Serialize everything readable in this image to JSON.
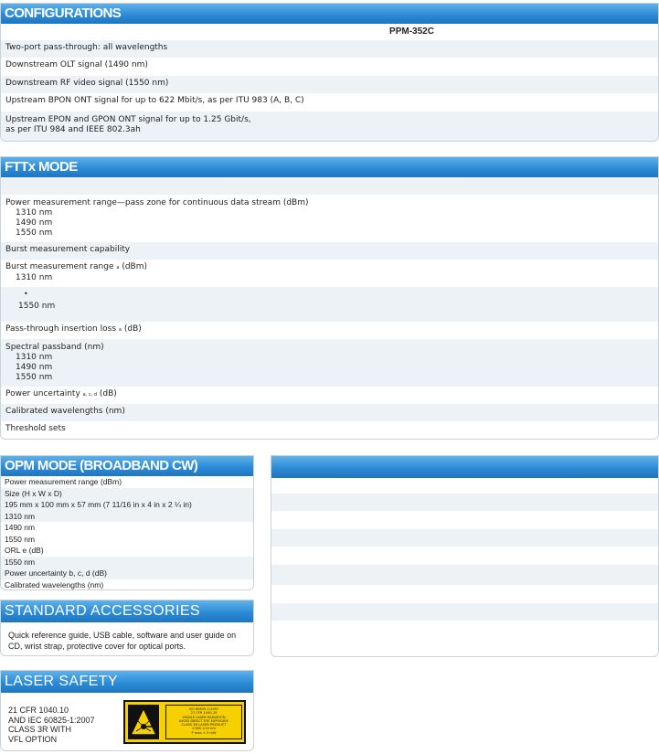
{
  "configurations": {
    "title": "CONFIGURATIONS",
    "column_header": "PPM-352C",
    "rows": [
      "Two-port pass-through: all wavelengths",
      "Downstream OLT signal (1490 nm)",
      "Downstream RF video signal (1550 nm)",
      "Upstream BPON ONT signal for up to 622 Mbit/s, as per ITU 983 (A, B, C)",
      "Upstream EPON and GPON ONT signal for up to 1.25 Gbit/s,",
      "as per ITU 984 and IEEE 802.3ah"
    ]
  },
  "fttx": {
    "title": "FTTx MODE",
    "power_range": {
      "label": "Power measurement range—pass zone for continuous data stream (dBm)",
      "w1": "1310 nm",
      "w2": "1490 nm",
      "w3": "1550 nm"
    },
    "burst_capability": "Burst measurement capability",
    "burst_range": {
      "label": "Burst measurement range",
      "sup": "a",
      "unit": "(dBm)",
      "w1": "1310 nm"
    },
    "bullet": "•",
    "w1550": "1550 nm",
    "insertion_loss": {
      "label": "Pass-through insertion loss",
      "sup": "a",
      "unit": "(dB)"
    },
    "passband": {
      "label": "Spectral passband (nm)",
      "w1": "1310 nm",
      "w2": "1490 nm",
      "w3": "1550 nm"
    },
    "uncertainty": {
      "label": "Power uncertainty",
      "sup": "a, c, d",
      "unit": "(dB)"
    },
    "calibrated": "Calibrated wavelengths (nm)",
    "threshold": "Threshold sets"
  },
  "opm": {
    "title": "OPM MODE (BROADBAND CW)",
    "rows": [
      "Power measurement range (dBm)",
      "Size (H x W x D)",
      "195 mm x 100 mm x 57 mm (7 11/16 in x 4 in x 2 ¼ in)",
      "1310 nm",
      "1490 nm",
      "1550 nm",
      "ORL e (dB)",
      "1550 nm",
      "Power uncertainty b, c, d (dB)",
      "Calibrated wavelengths (nm)"
    ]
  },
  "accessories": {
    "title": "STANDARD ACCESSORIES",
    "line1": "Quick reference guide, USB cable, software and user guide on",
    "line2": "CD, wrist strap, protective cover for optical ports."
  },
  "laser": {
    "title": "LASER SAFETY",
    "lines": [
      "21 CFR 1040.10",
      "AND IEC 60825-1:2007",
      "CLASS 3R WITH",
      "VFL OPTION"
    ],
    "label_lines": [
      "ISO 60825-1:2007",
      "21 CFR 1040.10",
      "VISIBLE LASER RADIATION",
      "AVOID DIRECT EYE EXPOSURE",
      "CLASS 3R LASER PRODUCT",
      "λ 650 ±10 nm",
      "P max < 5 mW"
    ]
  },
  "colors": {
    "header_blue": "#2d8bd6",
    "row_alt": "#edf2f7",
    "label_yellow": "#f6d000"
  }
}
